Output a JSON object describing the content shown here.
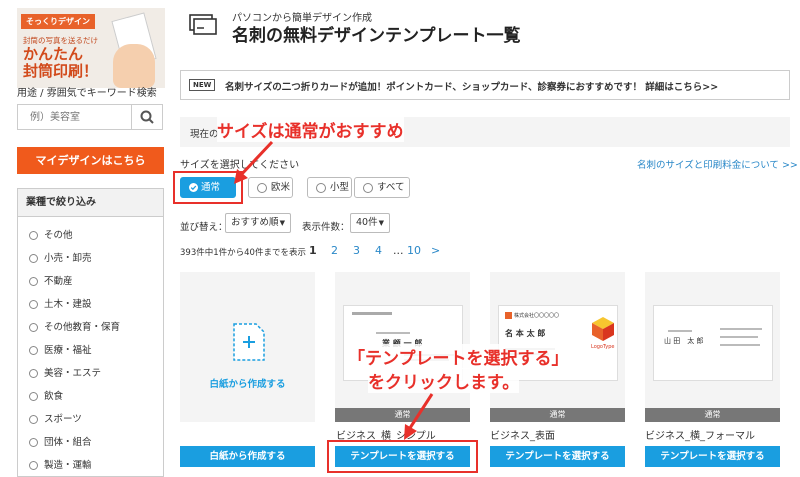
{
  "sidebar": {
    "banner": {
      "tag": "そっくりデザイン",
      "sub": "封筒の写真を送るだけ",
      "line1": "かんたん",
      "line2": "封筒印刷！"
    },
    "keyword_label": "用途 / 雰囲気でキーワード検索",
    "search_placeholder": "例）美容室",
    "mydesign_label": "マイデザインはこちら",
    "filter_title": "業種で絞り込み",
    "industries": [
      "その他",
      "小売・卸売",
      "不動産",
      "土木・建設",
      "その他教育・保育",
      "医療・福祉",
      "美容・エステ",
      "飲食",
      "スポーツ",
      "団体・組合",
      "製造・運輸"
    ]
  },
  "header": {
    "subtitle": "パソコンから簡単デザイン作成",
    "title": "名刺の無料デザインテンプレート一覧"
  },
  "notice": {
    "badge": "NEW",
    "text": "名刺サイズの二つ折りカードが追加！ポイントカード、ショップカード、診察券におすすめです！ 詳細はこちら>>"
  },
  "current_label": "現在の",
  "size": {
    "label": "サイズを選択してください",
    "link": "名刺のサイズと印刷料金について >>",
    "options": [
      "通常",
      "欧米",
      "小型",
      "すべて"
    ]
  },
  "sort": {
    "label": "並び替え：",
    "value": "おすすめ順",
    "count_label": "表示件数：",
    "count_value": "40件"
  },
  "result_count": "393件中1件から40件までを表示",
  "pagination": {
    "pages": [
      "1",
      "2",
      "3",
      "4",
      "...",
      "10"
    ],
    "next": ">"
  },
  "cards": [
    {
      "label": "白紙から作成する",
      "button": "白紙から作成する"
    },
    {
      "badge": "通常",
      "name": "ビジネス_横_シンプル",
      "button": "テンプレートを選択する",
      "sample_name": "業 顧 一 郎"
    },
    {
      "badge": "通常",
      "name": "ビジネス_表面",
      "button": "テンプレートを選択する",
      "sample_name": "名 本 太 郎",
      "logo": "LogoType",
      "company": "株式会社〇〇〇〇〇"
    },
    {
      "badge": "通常",
      "name": "ビジネス_横_フォーマル",
      "button": "テンプレートを選択する",
      "sample_name": "山 田　太 郎"
    }
  ],
  "annotations": {
    "size_callout": "サイズは通常がおすすめ",
    "select_callout_1": "「テンプレートを選択する」",
    "select_callout_2": "をクリックします。"
  },
  "colors": {
    "accent": "#1a9ee0",
    "orange": "#f05a1c",
    "annotation_red": "#e8302a"
  }
}
